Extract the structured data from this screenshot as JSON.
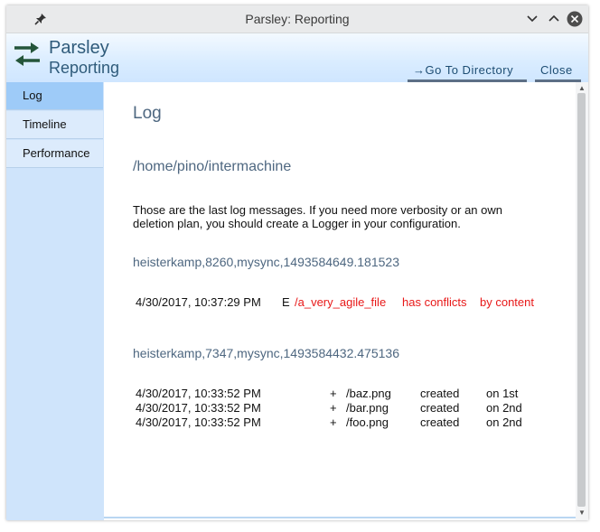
{
  "window": {
    "title": "Parsley: Reporting"
  },
  "header": {
    "app_name": "Parsley",
    "app_subtitle": "Reporting",
    "go_to_directory": "→Go To Directory",
    "close": "Close"
  },
  "sidebar": {
    "items": [
      {
        "label": "Log"
      },
      {
        "label": "Timeline"
      },
      {
        "label": "Performance"
      }
    ]
  },
  "main": {
    "heading": "Log",
    "path": "/home/pino/intermachine",
    "description": "Those are the last log messages. If you need more verbosity or an own deletion plan, you should create a Logger in your configuration.",
    "sections": [
      {
        "title": "heisterkamp,8260,mysync,1493584649.181523",
        "entries": [
          {
            "time": "4/30/2017, 10:37:29 PM",
            "sign": "E",
            "file": "/a_very_agile_file",
            "action": "has conflicts",
            "detail": "by content"
          }
        ]
      },
      {
        "title": "heisterkamp,7347,mysync,1493584432.475136",
        "entries": [
          {
            "time": "4/30/2017, 10:33:52 PM",
            "sign": "+",
            "file": "/baz.png",
            "action": "created",
            "detail": "on 1st"
          },
          {
            "time": "4/30/2017, 10:33:52 PM",
            "sign": "+",
            "file": "/bar.png",
            "action": "created",
            "detail": "on 2nd"
          },
          {
            "time": "4/30/2017, 10:33:52 PM",
            "sign": "+",
            "file": "/foo.png",
            "action": "created",
            "detail": "on 2nd"
          }
        ]
      }
    ]
  },
  "colors": {
    "accent": "#9ecbf8",
    "error": "#e81818",
    "heading": "#4e6780"
  }
}
